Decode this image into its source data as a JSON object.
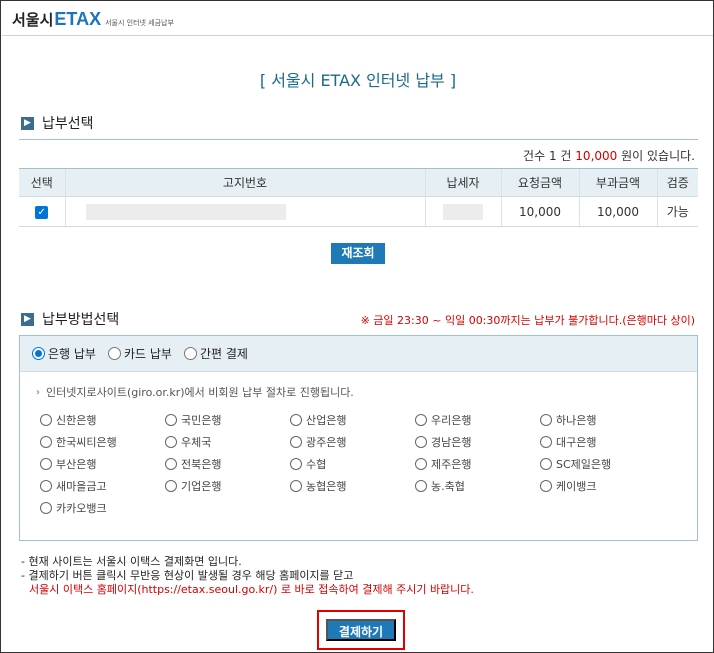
{
  "header": {
    "logo_ko": "서울시",
    "logo_en": "ETAX",
    "logo_sub": "서울시 인터넷 세금납부"
  },
  "page_title": "[ 서울시 ETAX 인터넷 납부 ]",
  "select_section": {
    "title": "납부선택",
    "count_prefix": "건수",
    "count": "1",
    "count_unit": "건",
    "amount": "10,000",
    "count_suffix": "원이 있습니다.",
    "columns": [
      "선택",
      "고지번호",
      "납세자",
      "요청금액",
      "부과금액",
      "검증"
    ],
    "rows": [
      {
        "selected": true,
        "notice_no": "",
        "taxpayer": "",
        "request_amount": "10,000",
        "levy_amount": "10,000",
        "verify": "가능"
      }
    ],
    "reload_button": "재조회"
  },
  "method_section": {
    "title": "납부방법선택",
    "notice": "※ 금일 23:30 ~ 익일 00:30까지는 납부가 불가합니다.(은행마다 상이)",
    "tabs": [
      {
        "label": "은행 납부",
        "selected": true
      },
      {
        "label": "카드 납부",
        "selected": false
      },
      {
        "label": "간편 결제",
        "selected": false
      }
    ],
    "giro_note": "인터넷지로사이트(giro.or.kr)에서 비회원 납부 절차로 진행됩니다.",
    "banks": [
      "신한은행",
      "국민은행",
      "산업은행",
      "우리은행",
      "하나은행",
      "한국씨티은행",
      "우체국",
      "광주은행",
      "경남은행",
      "대구은행",
      "부산은행",
      "전북은행",
      "수협",
      "제주은행",
      "SC제일은행",
      "새마을금고",
      "기업은행",
      "농협은행",
      "농.축협",
      "케이뱅크",
      "카카오뱅크"
    ]
  },
  "footnotes": {
    "line1": "- 현재 사이트는 서울시 이택스 결제화면 입니다.",
    "line2": "- 결제하기 버튼 클릭시 무반응 현상이 발생될 경우 해당 홈페이지를 닫고",
    "line3": "서울시 이택스 홈페이지(https://etax.seoul.go.kr/) 로 바로 접속하여 결제해 주시기 바랍니다."
  },
  "pay_button": "결제하기",
  "colors": {
    "accent": "#1e79b7",
    "warning": "#d40000",
    "header_bg": "#e6f0f4"
  }
}
